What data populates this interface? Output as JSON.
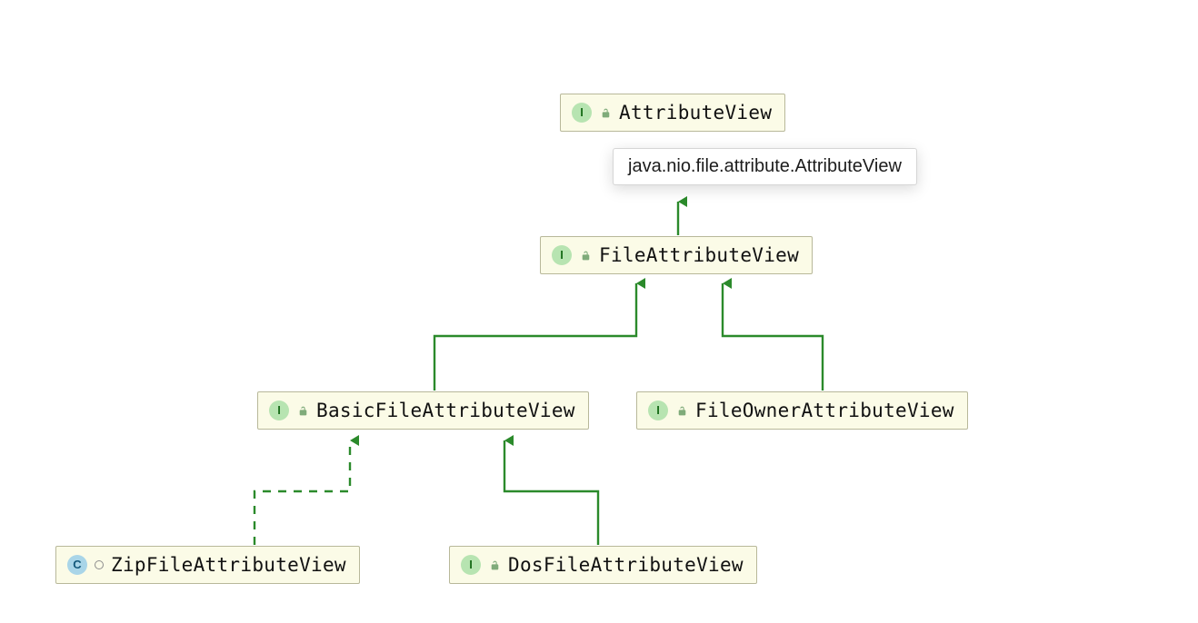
{
  "tooltip": {
    "text": "java.nio.file.attribute.AttributeView"
  },
  "nodes": {
    "attributeView": {
      "name": "AttributeView",
      "kind": "interface",
      "kindLetter": "I",
      "visibility": "public"
    },
    "fileAttributeView": {
      "name": "FileAttributeView",
      "kind": "interface",
      "kindLetter": "I",
      "visibility": "public"
    },
    "basicFileAttributeView": {
      "name": "BasicFileAttributeView",
      "kind": "interface",
      "kindLetter": "I",
      "visibility": "public"
    },
    "fileOwnerAttributeView": {
      "name": "FileOwnerAttributeView",
      "kind": "interface",
      "kindLetter": "I",
      "visibility": "public"
    },
    "zipFileAttributeView": {
      "name": "ZipFileAttributeView",
      "kind": "class",
      "kindLetter": "C",
      "visibility": "package-private"
    },
    "dosFileAttributeView": {
      "name": "DosFileAttributeView",
      "kind": "interface",
      "kindLetter": "I",
      "visibility": "public"
    }
  },
  "edges": [
    {
      "from": "fileAttributeView",
      "to": "attributeView",
      "style": "solid"
    },
    {
      "from": "basicFileAttributeView",
      "to": "fileAttributeView",
      "style": "solid"
    },
    {
      "from": "fileOwnerAttributeView",
      "to": "fileAttributeView",
      "style": "solid"
    },
    {
      "from": "dosFileAttributeView",
      "to": "basicFileAttributeView",
      "style": "solid"
    },
    {
      "from": "zipFileAttributeView",
      "to": "basicFileAttributeView",
      "style": "dashed"
    }
  ],
  "colors": {
    "edge": "#2b8a2b",
    "nodeFill": "#fbfbe7",
    "nodeBorder": "#b8b89a"
  }
}
